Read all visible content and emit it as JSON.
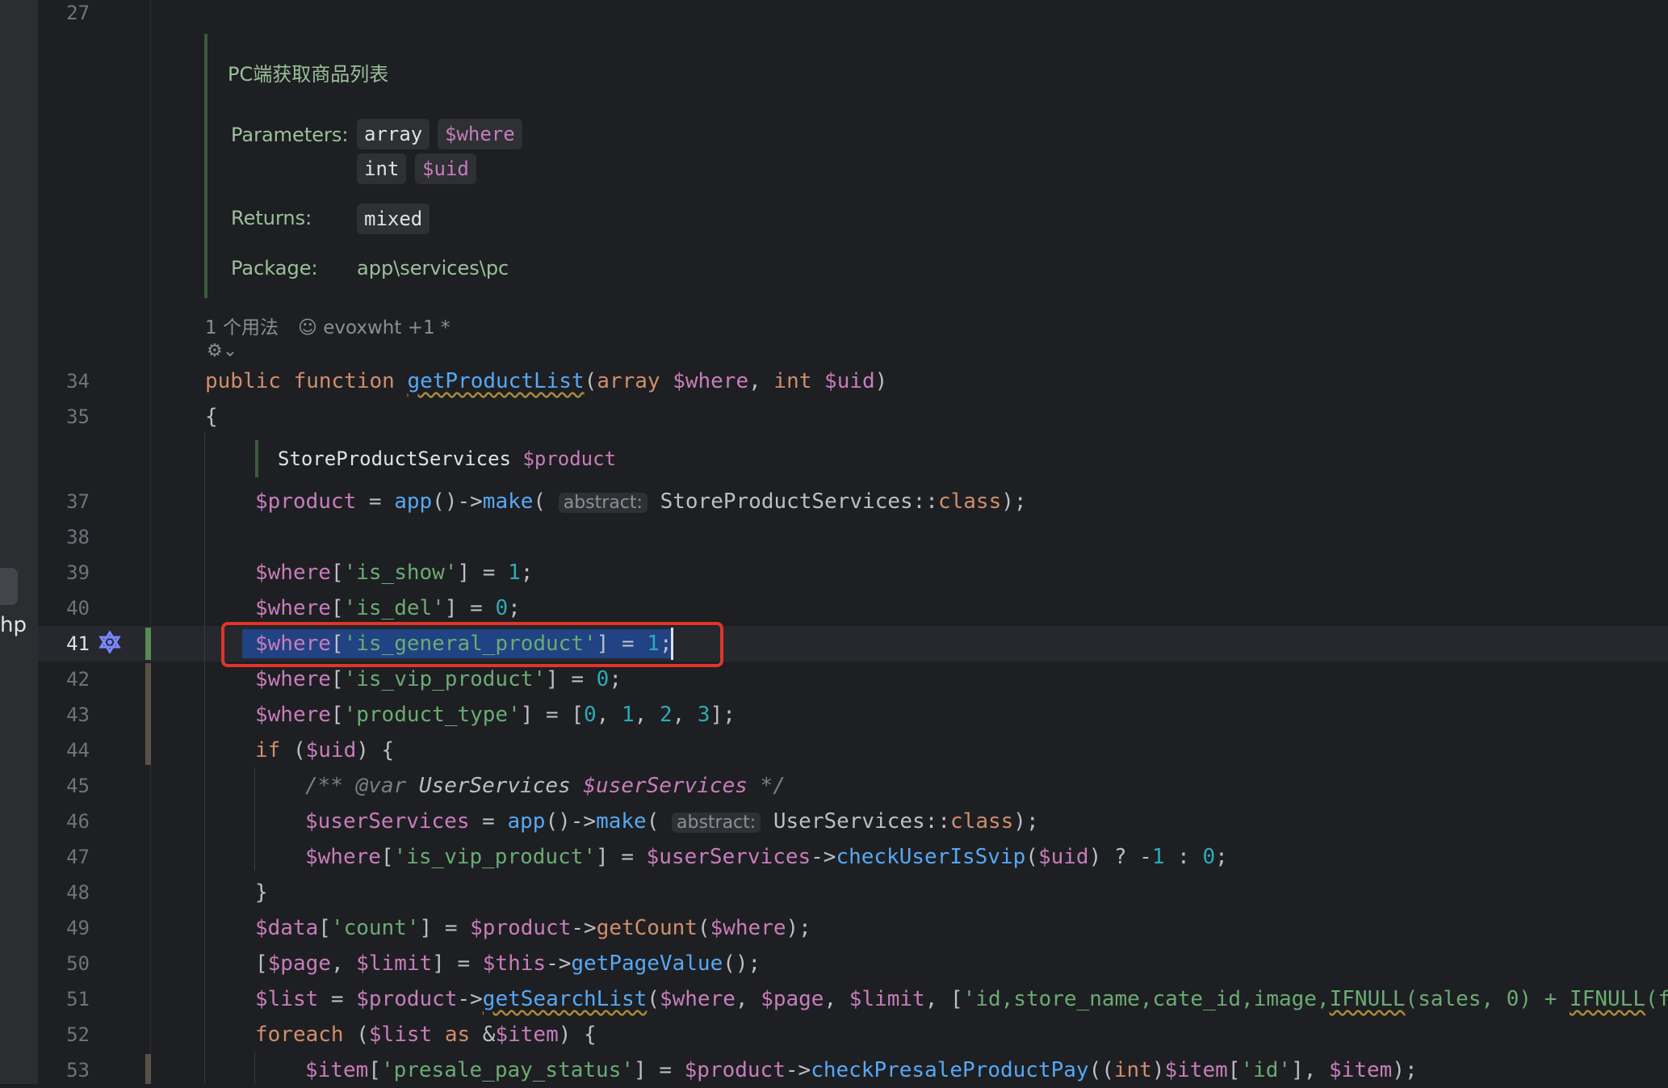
{
  "sidebar": {
    "file_suffix": "hp"
  },
  "docblock": {
    "summary": "PC端获取商品列表",
    "parameters_label": "Parameters:",
    "param1_type": "array",
    "param1_name": "$where",
    "param2_type": "int",
    "param2_name": "$uid",
    "returns_label": "Returns:",
    "returns_type": "mixed",
    "package_label": "Package:",
    "package_value": "app\\services\\pc"
  },
  "usage_info": {
    "usages": "1 个用法",
    "authors": "evoxwht +1 *"
  },
  "inline_type_hint": {
    "type": "StoreProductServices",
    "var": "$product"
  },
  "param_hint": "abstract:",
  "line_numbers": {
    "l27": "27",
    "l34": "34",
    "l35": "35",
    "l37": "37",
    "l38": "38",
    "l39": "39",
    "l40": "40",
    "l41": "41",
    "l42": "42",
    "l43": "43",
    "l44": "44",
    "l45": "45",
    "l46": "46",
    "l47": "47",
    "l48": "48",
    "l49": "49",
    "l50": "50",
    "l51": "51",
    "l52": "52",
    "l53": "53"
  },
  "current_line": "41",
  "highlighted_code": "$where['is_general_product'] = 1;",
  "colors": {
    "highlight_box": "#e0352b",
    "selection": "#214283",
    "background": "#1e1f22"
  }
}
